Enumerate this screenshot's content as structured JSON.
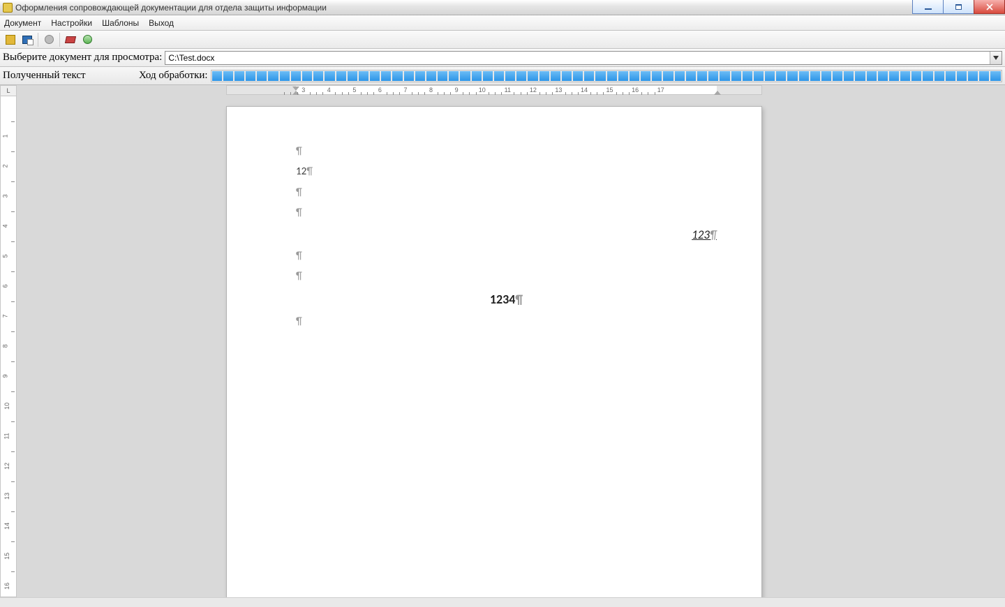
{
  "window": {
    "title": "Оформления сопровождающей документации для отдела защиты информации"
  },
  "menu": {
    "items": [
      "Документ",
      "Настройки",
      "Шаблоны",
      "Выход"
    ]
  },
  "file_selector": {
    "label": "Выберите документ для просмотра:",
    "value": "C:\\Test.docx"
  },
  "status": {
    "label_left": "Полученный текст",
    "label_progress": "Ход обработки:"
  },
  "progress": {
    "segments": 70,
    "percent": 100
  },
  "ruler": {
    "corner": "L",
    "h_range": [
      3,
      17
    ],
    "v_range": [
      1,
      16
    ]
  },
  "document": {
    "paragraphs": [
      {
        "text": "",
        "align": "left"
      },
      {
        "text": "12",
        "align": "left"
      },
      {
        "text": "",
        "align": "left"
      },
      {
        "text": "",
        "align": "left"
      },
      {
        "text": "123",
        "align": "right"
      },
      {
        "text": "",
        "align": "left"
      },
      {
        "text": "",
        "align": "left"
      },
      {
        "text": "1234",
        "align": "center"
      },
      {
        "text": "",
        "align": "left"
      }
    ]
  },
  "pilcrow": "¶"
}
